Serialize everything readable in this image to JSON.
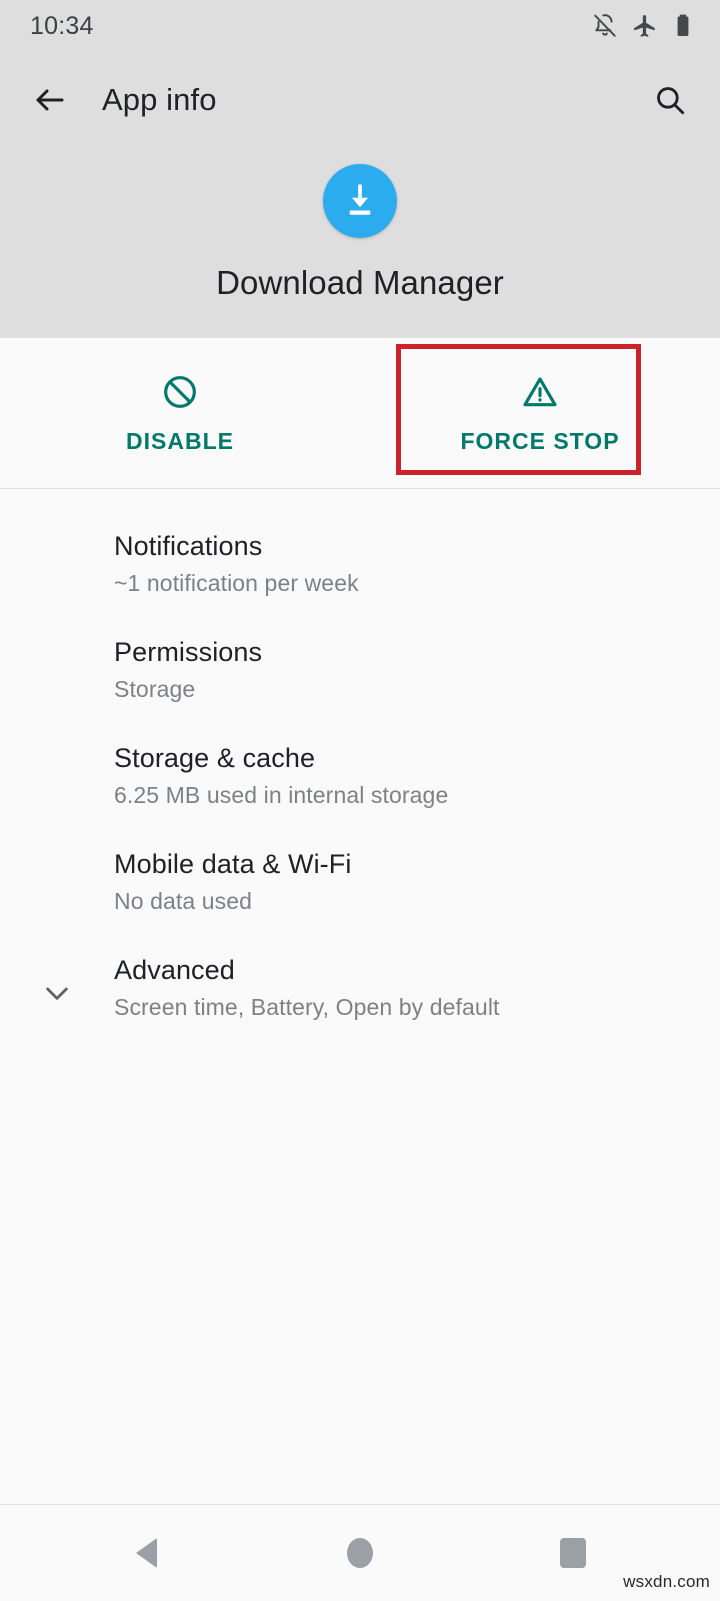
{
  "status_bar": {
    "time": "10:34",
    "icons": [
      {
        "name": "notifications-off-icon",
        "label": "Notifications off"
      },
      {
        "name": "airplane-mode-icon",
        "label": "Airplane mode"
      },
      {
        "name": "battery-icon",
        "label": "Battery"
      }
    ]
  },
  "toolbar": {
    "back_icon": "back-arrow-icon",
    "title": "App info",
    "search_icon": "search-icon"
  },
  "app": {
    "icon_name": "download-manager-icon",
    "name": "Download Manager",
    "icon_color": "#2BACEE"
  },
  "actions": {
    "accent_color": "#00796B",
    "items": [
      {
        "icon": "block-icon",
        "label": "DISABLE"
      },
      {
        "icon": "warning-triangle-icon",
        "label": "FORCE STOP"
      }
    ],
    "annotation": {
      "target": "FORCE STOP",
      "color": "#CC2229"
    }
  },
  "settings_list": [
    {
      "title": "Notifications",
      "subtitle": "~1 notification per week",
      "expand_icon": ""
    },
    {
      "title": "Permissions",
      "subtitle": "Storage",
      "expand_icon": ""
    },
    {
      "title": "Storage & cache",
      "subtitle": "6.25 MB used in internal storage",
      "expand_icon": ""
    },
    {
      "title": "Mobile data & Wi-Fi",
      "subtitle": "No data used",
      "expand_icon": ""
    },
    {
      "title": "Advanced",
      "subtitle": "Screen time, Battery, Open by default",
      "expand_icon": "chevron-down-icon"
    }
  ],
  "nav_bar": {
    "back": "back-nav-button",
    "home": "home-nav-button",
    "recents": "recents-nav-button"
  },
  "watermark": "wsxdn.com"
}
